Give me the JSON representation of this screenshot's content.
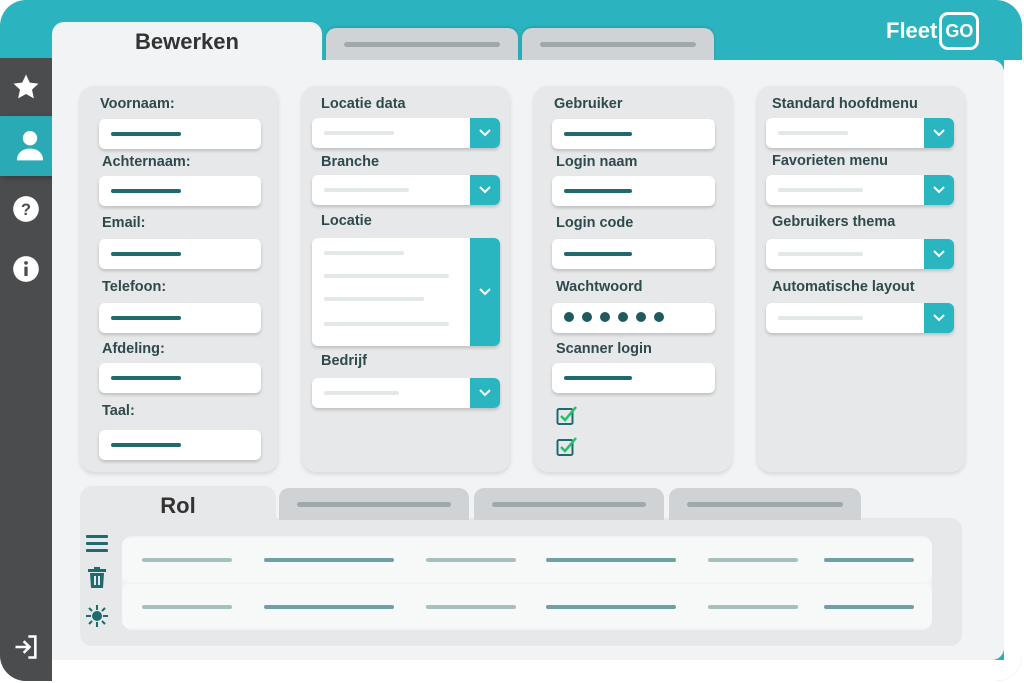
{
  "app": {
    "logo_text": "Fleet",
    "logo_box_text": "GO",
    "accent": "#2ab6c1",
    "sidebar_color": "#4a4c4e"
  },
  "tabs": {
    "main": "Bewerken"
  },
  "sidebar": [
    "star-icon",
    "user-icon",
    "help-icon",
    "info-icon",
    "logout-icon"
  ],
  "personal": {
    "voornaam": "Voornaam:",
    "achternaam": "Achternaam:",
    "email": "Email:",
    "telefoon": "Telefoon:",
    "afdeling": "Afdeling:",
    "taal": "Taal:"
  },
  "location": {
    "locatie_data": "Locatie data",
    "branche": "Branche",
    "locatie": "Locatie",
    "bedrijf": "Bedrijf"
  },
  "account": {
    "gebruiker": "Gebruiker",
    "login_naam": "Login naam",
    "login_code": "Login code",
    "wachtwoord": "Wachtwoord",
    "scanner_login": "Scanner login"
  },
  "settings": {
    "standard_menu": "Standard hoofdmenu",
    "favorieten": "Favorieten menu",
    "thema": "Gebruikers thema",
    "layout": "Automatische layout"
  },
  "bottom": {
    "rol_tab": "Rol"
  }
}
